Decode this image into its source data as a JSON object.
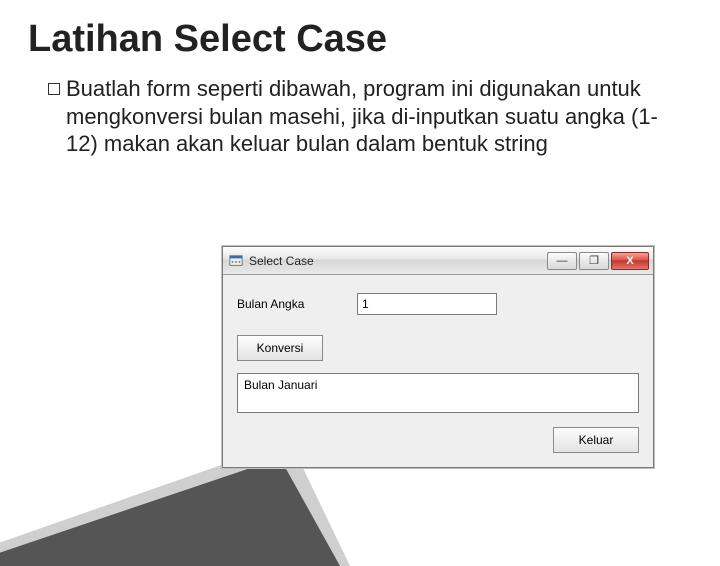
{
  "slide": {
    "title": "Latihan Select Case",
    "bullet_lead": "Buatlah",
    "bullet_rest": " form seperti dibawah, program ini digunakan untuk mengkonversi bulan masehi, jika di-inputkan suatu angka (1-12) makan akan keluar bulan dalam bentuk string"
  },
  "window": {
    "title": "Select Case",
    "controls": {
      "minimize": "—",
      "maximize": "❐",
      "close": "X"
    },
    "label_bulan_angka": "Bulan Angka",
    "input_value": "1",
    "konversi_btn": "Konversi",
    "output_value": "Bulan Januari",
    "keluar_btn": "Keluar"
  }
}
